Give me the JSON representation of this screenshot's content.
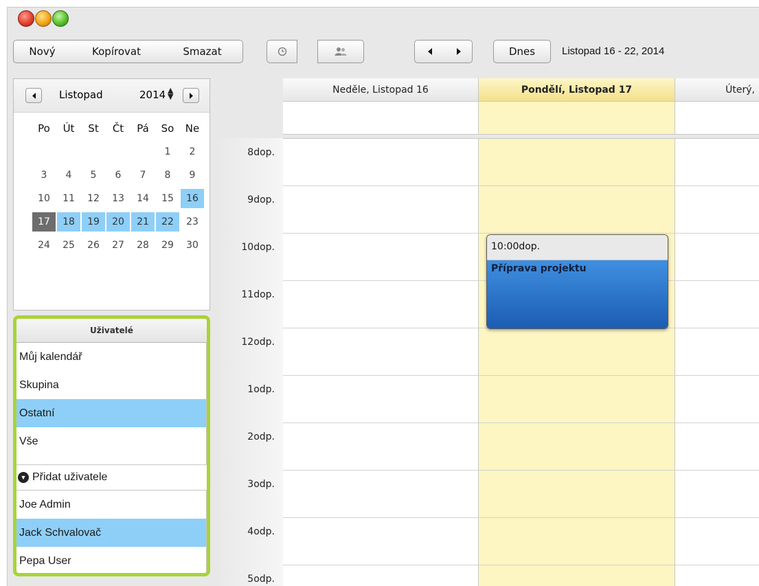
{
  "toolbar": {
    "new_label": "Nový",
    "copy_label": "Kopírovat",
    "delete_label": "Smazat",
    "today_label": "Dnes",
    "date_range": "Listopad 16 - 22, 2014",
    "icons": [
      "clock-icon",
      "users-icon",
      "arrow-left-icon",
      "arrow-right-icon"
    ]
  },
  "mini_calendar": {
    "month": "Listopad",
    "year": "2014",
    "weekdays": [
      "Po",
      "Út",
      "St",
      "Čt",
      "Pá",
      "So",
      "Ne"
    ],
    "weeks": [
      [
        "",
        "",
        "",
        "",
        "",
        "1",
        "2"
      ],
      [
        "3",
        "4",
        "5",
        "6",
        "7",
        "8",
        "9"
      ],
      [
        "10",
        "11",
        "12",
        "13",
        "14",
        "15",
        "16"
      ],
      [
        "17",
        "18",
        "19",
        "20",
        "21",
        "22",
        "23"
      ],
      [
        "24",
        "25",
        "26",
        "27",
        "28",
        "29",
        "30"
      ]
    ],
    "selected_days": [
      "16",
      "18",
      "19",
      "20",
      "21",
      "22"
    ],
    "today": "17"
  },
  "users_panel": {
    "header": "Uživatelé",
    "filters": [
      {
        "label": "Můj kalendář",
        "selected": false
      },
      {
        "label": "Skupina",
        "selected": false
      },
      {
        "label": "Ostatní",
        "selected": true
      },
      {
        "label": "Vše",
        "selected": false
      }
    ],
    "add_user_label": "Přidat uživatele",
    "users": [
      {
        "label": "Joe Admin",
        "selected": false
      },
      {
        "label": "Jack Schvalovač",
        "selected": true
      },
      {
        "label": "Pepa User",
        "selected": false
      }
    ]
  },
  "week_view": {
    "days": [
      {
        "label": "Neděle, Listopad 16",
        "today": false
      },
      {
        "label": "Pondělí, Listopad 17",
        "today": true
      },
      {
        "label": "Úterý,",
        "today": false
      }
    ],
    "hours": [
      "8dop.",
      "9dop.",
      "10dop.",
      "11dop.",
      "12odp.",
      "1odp.",
      "2odp.",
      "3odp.",
      "4odp.",
      "5odp."
    ],
    "event": {
      "time": "10:00dop.",
      "title": "Příprava projektu"
    }
  },
  "colors": {
    "selection": "#8ecff8",
    "today_column": "#fdf5c2",
    "highlight_border": "#a8d436",
    "event_blue": "#2e78cf"
  }
}
